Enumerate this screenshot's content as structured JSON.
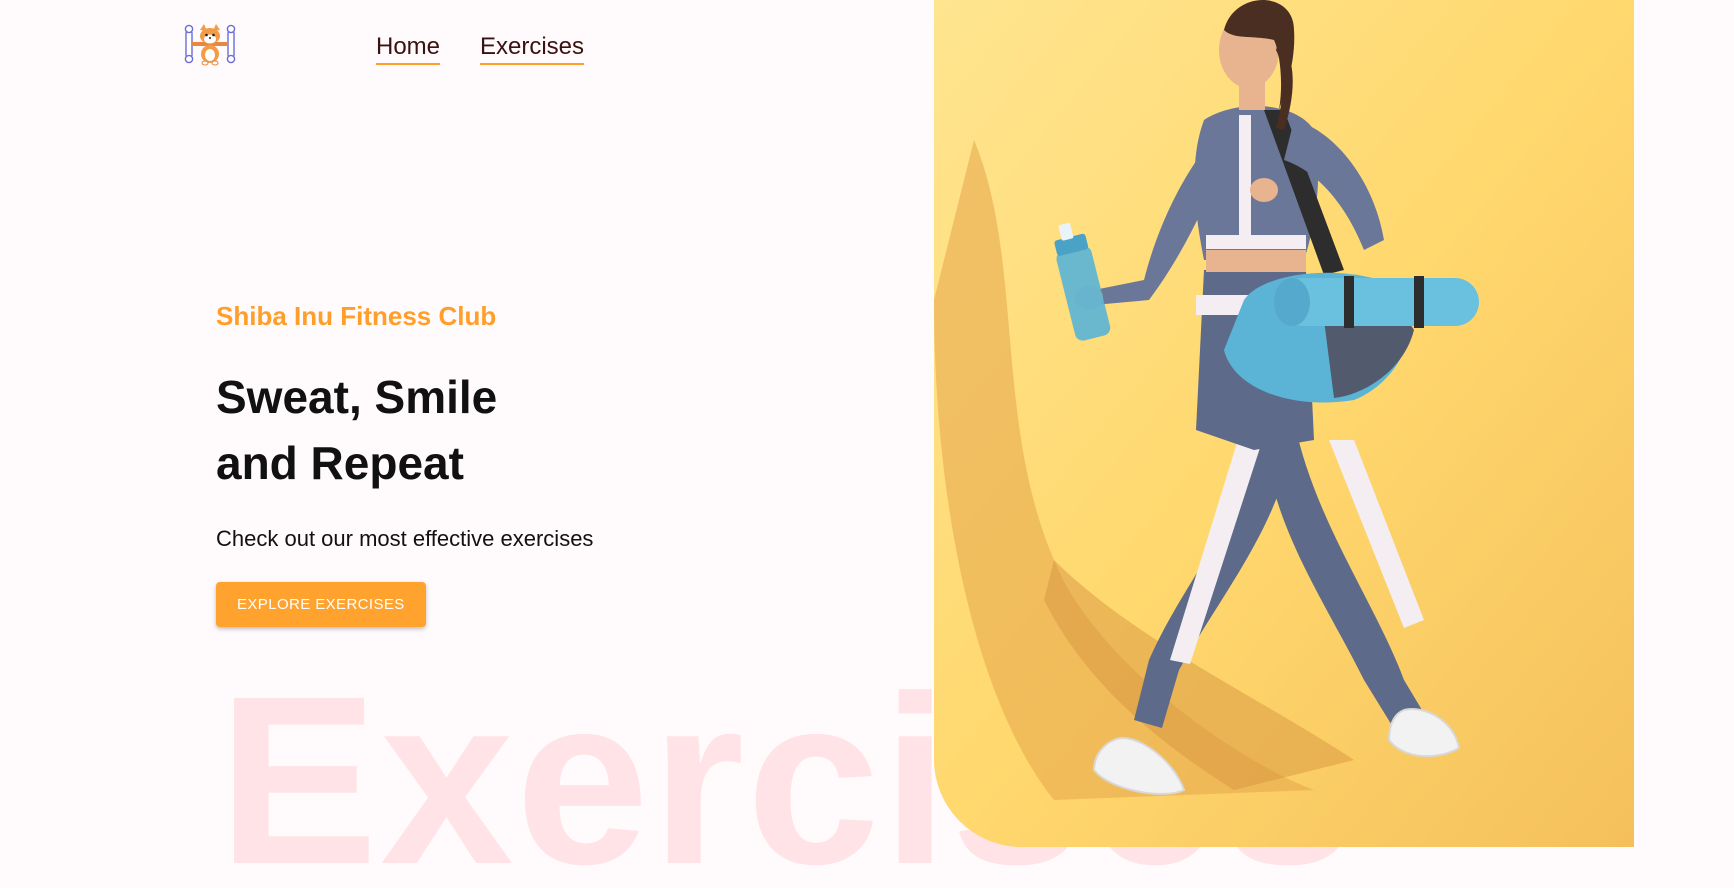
{
  "nav": {
    "logo_alt": "Shiba Inu logo",
    "links": [
      {
        "label": "Home"
      },
      {
        "label": "Exercises"
      }
    ]
  },
  "hero": {
    "brand": "Shiba Inu Fitness Club",
    "headline_line1": "Sweat, Smile",
    "headline_line2": "and Repeat",
    "subline": "Check out our most effective exercises",
    "cta_label": "EXPLORE EXERCISES",
    "watermark": "Exercises",
    "image_subject": "woman-walking-with-gym-bag-and-shaker"
  },
  "colors": {
    "accent": "#ffa32e",
    "background": "#fffafb",
    "watermark": "#ffe3e6",
    "nav_text": "#3a1212"
  }
}
